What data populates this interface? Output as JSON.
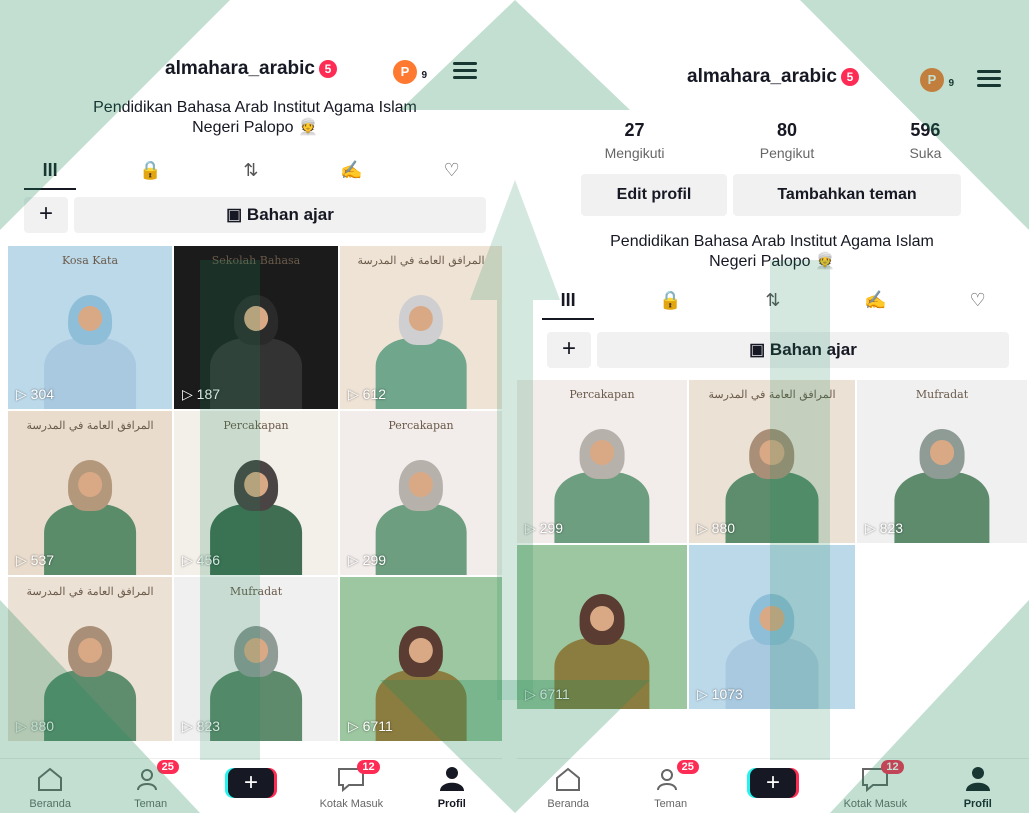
{
  "left": {
    "username": "almahara_arabic",
    "notif_count": "5",
    "avatar_letter": "P",
    "avatar_sub": "9",
    "bio": "Pendidikan Bahasa Arab Institut Agama Islam Negeri Palopo 👳",
    "tabs": [
      "III",
      "🔒",
      "⇅",
      "✍",
      "♡"
    ],
    "collection_label": "Bahan ajar",
    "plus": "+",
    "videos": [
      {
        "views": "304",
        "title": "Kosa Kata"
      },
      {
        "views": "187",
        "title": "Sekolah Bahasa"
      },
      {
        "views": "612",
        "title": "المرافق العامة في المدرسة"
      },
      {
        "views": "537",
        "title": "المرافق العامة في المدرسة"
      },
      {
        "views": "456",
        "title": "Percakapan"
      },
      {
        "views": "299",
        "title": "Percakapan"
      },
      {
        "views": "880",
        "title": "المرافق العامة في المدرسة"
      },
      {
        "views": "823",
        "title": "Mufradat"
      },
      {
        "views": "6711",
        "title": ""
      }
    ]
  },
  "right": {
    "username": "almahara_arabic",
    "notif_count": "5",
    "avatar_letter": "P",
    "avatar_sub": "9",
    "stats": [
      {
        "num": "27",
        "label": "Mengikuti"
      },
      {
        "num": "80",
        "label": "Pengikut"
      },
      {
        "num": "596",
        "label": "Suka"
      }
    ],
    "edit_profile": "Edit profil",
    "add_friends": "Tambahkan teman",
    "bio": "Pendidikan Bahasa Arab Institut Agama Islam Negeri Palopo 👳",
    "tabs": [
      "III",
      "🔒",
      "⇅",
      "✍",
      "♡"
    ],
    "collection_label": "Bahan ajar",
    "plus": "+",
    "videos": [
      {
        "views": "299",
        "title": "Percakapan"
      },
      {
        "views": "880",
        "title": "المرافق العامة في المدرسة"
      },
      {
        "views": "823",
        "title": "Mufradat"
      },
      {
        "views": "6711",
        "title": ""
      },
      {
        "views": "1073",
        "title": ""
      }
    ]
  },
  "nav": {
    "home": "Beranda",
    "friends": "Teman",
    "friends_badge": "25",
    "create": "+",
    "inbox": "Kotak Masuk",
    "inbox_badge": "12",
    "profile": "Profil"
  },
  "colors": {
    "accent": "#fe2c55",
    "cyan": "#25f4ee",
    "watermark": "#1f8a5b"
  }
}
